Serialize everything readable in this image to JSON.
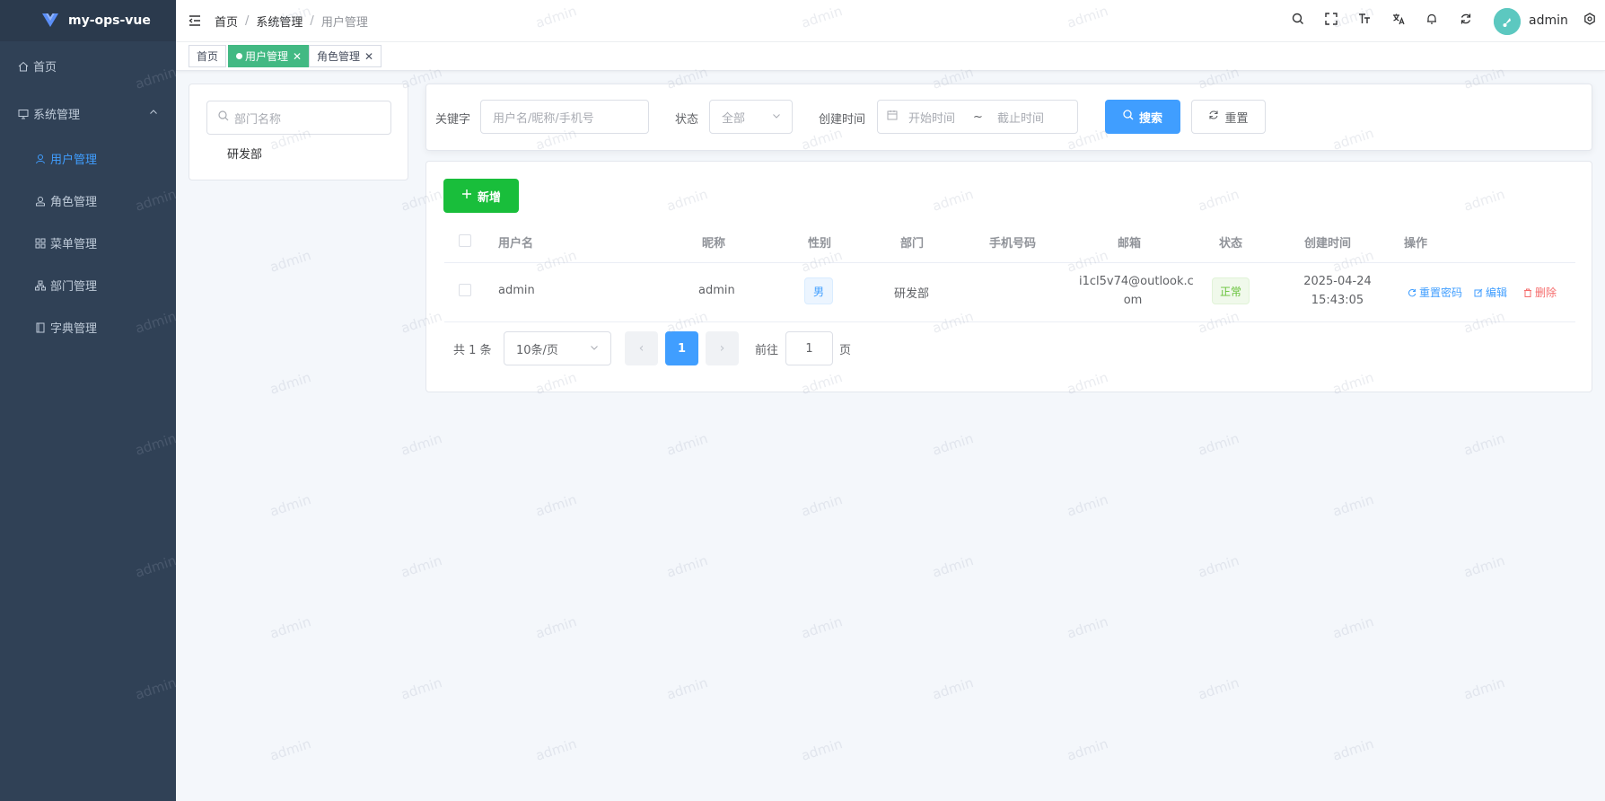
{
  "app": {
    "title": "my-ops-vue"
  },
  "sidebar": {
    "items": [
      {
        "label": "首页"
      },
      {
        "label": "系统管理"
      },
      {
        "label": "用户管理"
      },
      {
        "label": "角色管理"
      },
      {
        "label": "菜单管理"
      },
      {
        "label": "部门管理"
      },
      {
        "label": "字典管理"
      }
    ]
  },
  "header": {
    "breadcrumb": [
      "首页",
      "系统管理",
      "用户管理"
    ],
    "breadcrumb_sep": "/",
    "username": "admin"
  },
  "tags": [
    {
      "label": "首页"
    },
    {
      "label": "用户管理"
    },
    {
      "label": "角色管理"
    }
  ],
  "dept": {
    "search_placeholder": "部门名称",
    "nodes": [
      "研发部"
    ]
  },
  "search": {
    "keyword_label": "关键字",
    "keyword_placeholder": "用户名/昵称/手机号",
    "status_label": "状态",
    "status_value": "全部",
    "created_label": "创建时间",
    "start_placeholder": "开始时间",
    "range_sep": "~",
    "end_placeholder": "截止时间",
    "search_button": "搜索",
    "reset_button": "重置"
  },
  "table": {
    "add_button": "新增",
    "columns": [
      "用户名",
      "昵称",
      "性别",
      "部门",
      "手机号码",
      "邮箱",
      "状态",
      "创建时间",
      "操作"
    ],
    "rows": [
      {
        "username": "admin",
        "nickname": "admin",
        "gender": "男",
        "dept": "研发部",
        "phone": "",
        "email_line1": "i1cl5v74@outlook.c",
        "email_line2": "om",
        "status": "正常",
        "created_date": "2025-04-24",
        "created_time": "15:43:05",
        "actions": [
          "重置密码",
          "编辑",
          "删除"
        ]
      }
    ]
  },
  "pagination": {
    "total": "共 1 条",
    "page_size": "10条/页",
    "current_page": "1",
    "goto_label": "前往",
    "goto_value": "1",
    "page_suffix": "页"
  },
  "watermark": "admin",
  "colors": {
    "sidebar_bg": "#304156",
    "accent": "#409eff",
    "tag_active": "#42b983",
    "add_button": "#19be3b",
    "danger": "#f56c6c"
  }
}
